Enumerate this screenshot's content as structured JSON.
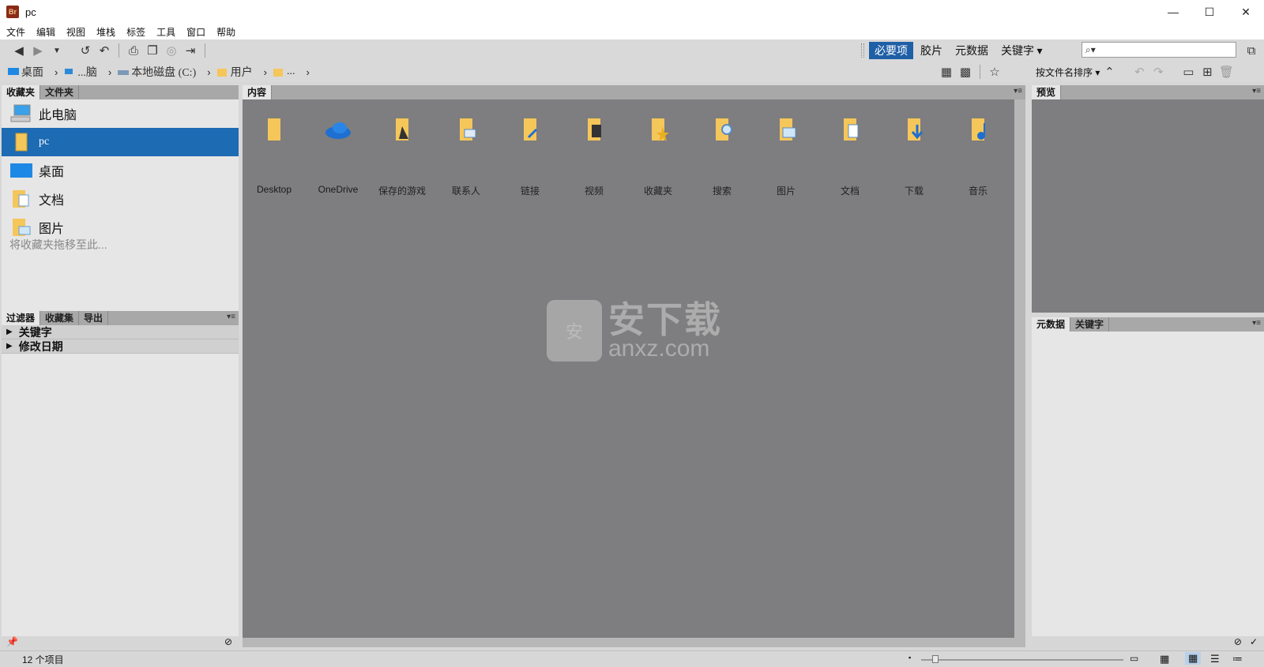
{
  "window": {
    "title": "pc",
    "minimize": "—",
    "maximize": "☐",
    "close": "✕"
  },
  "menu": [
    "文件",
    "编辑",
    "视图",
    "堆栈",
    "标签",
    "工具",
    "窗口",
    "帮助"
  ],
  "workspace": {
    "items": [
      "必要项",
      "胶片",
      "元数据",
      "关键字 ▾"
    ],
    "active_index": 0
  },
  "search": {
    "placeholder": "⌕▾"
  },
  "path": {
    "crumbs": [
      "桌面",
      "...脑",
      "本地磁盘 (C:)",
      "用户",
      "..."
    ],
    "sort_label": "按文件名排序 ▾"
  },
  "panels": {
    "favorites_tabs": [
      "收藏夹",
      "文件夹"
    ],
    "filter_tabs": [
      "过滤器",
      "收藏集",
      "导出"
    ],
    "content_tab": "内容",
    "preview_tab": "预览",
    "meta_tabs": [
      "元数据",
      "关键字"
    ]
  },
  "favorites": {
    "items": [
      "此电脑",
      "pc",
      "桌面",
      "文档",
      "图片"
    ],
    "selected": "pc",
    "hint": "将收藏夹拖移至此..."
  },
  "filters": [
    "关键字",
    "修改日期"
  ],
  "content": {
    "items": [
      "Desktop",
      "OneDrive",
      "保存的游戏",
      "联系人",
      "链接",
      "视频",
      "收藏夹",
      "搜索",
      "图片",
      "文档",
      "下载",
      "音乐"
    ]
  },
  "watermark": {
    "cn": "安下载",
    "en": "anxz.com",
    "badge": "安"
  },
  "status": {
    "count": "12 个项目"
  },
  "colors": {
    "accent": "#1d6bb3",
    "content_bg": "#7e7d7f",
    "panel_bg": "#e6e6e6",
    "folder": "#f5c65a"
  }
}
